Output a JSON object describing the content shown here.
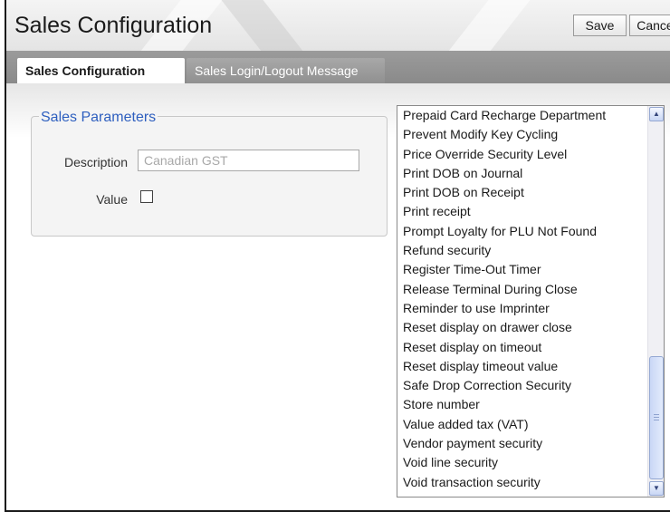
{
  "header": {
    "title": "Sales Configuration",
    "save_label": "Save",
    "cancel_label": "Cancel"
  },
  "tabs": [
    {
      "label": "Sales Configuration",
      "active": true
    },
    {
      "label": "Sales Login/Logout Message",
      "active": false
    }
  ],
  "sales_parameters": {
    "legend": "Sales Parameters",
    "description_label": "Description",
    "description_value": "Canadian GST",
    "value_label": "Value",
    "value_checked": false
  },
  "parameters_list": {
    "items": [
      "Prepaid Card Recharge Department",
      "Prevent Modify Key Cycling",
      "Price Override Security Level",
      "Print DOB on Journal",
      "Print DOB on Receipt",
      "Print receipt",
      "Prompt Loyalty for PLU Not Found",
      "Refund security",
      "Register Time-Out Timer",
      "Release Terminal During Close",
      "Reminder to use Imprinter",
      "Reset display on drawer close",
      "Reset display on timeout",
      "Reset display timeout value",
      "Safe Drop Correction Security",
      "Store number",
      "Value added tax (VAT)",
      "Vendor payment security",
      "Void line security",
      "Void transaction security"
    ]
  },
  "colors": {
    "legend": "#2e5fbf",
    "tab_bar": "#8f8f8f",
    "scrollbar_thumb": "#c9d7f6"
  }
}
